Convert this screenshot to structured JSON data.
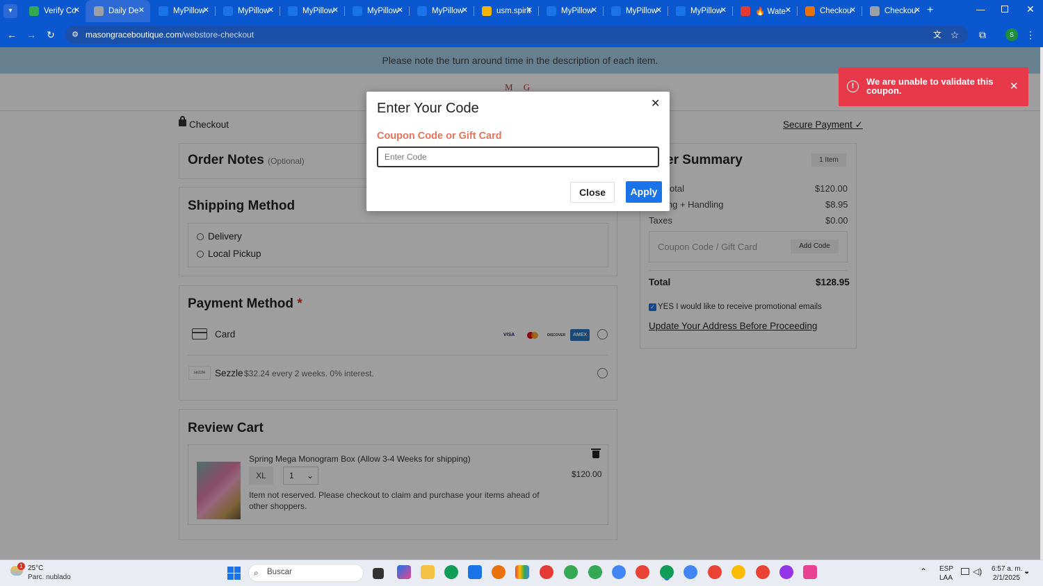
{
  "browser": {
    "tabs": [
      {
        "title": "Verify Co",
        "icon": "check-badge-icon",
        "icon_color": "#34a853"
      },
      {
        "title": "Daily De",
        "icon": "globe-icon",
        "icon_color": "#9aa0a6",
        "active": true
      },
      {
        "title": "MyPillow",
        "icon": "mypillow-icon",
        "icon_color": "#1a73e8"
      },
      {
        "title": "MyPillow",
        "icon": "mypillow-icon",
        "icon_color": "#1a73e8"
      },
      {
        "title": "MyPillow",
        "icon": "mypillow-icon",
        "icon_color": "#1a73e8"
      },
      {
        "title": "MyPillow",
        "icon": "mypillow-icon",
        "icon_color": "#1a73e8"
      },
      {
        "title": "MyPillow",
        "icon": "mypillow-icon",
        "icon_color": "#1a73e8"
      },
      {
        "title": "usm.spirit",
        "icon": "usm-icon",
        "icon_color": "#f4b400"
      },
      {
        "title": "MyPillow",
        "icon": "mypillow-icon",
        "icon_color": "#1a73e8"
      },
      {
        "title": "MyPillow",
        "icon": "mypillow-icon",
        "icon_color": "#1a73e8"
      },
      {
        "title": "MyPillow",
        "icon": "mypillow-icon",
        "icon_color": "#1a73e8"
      },
      {
        "title": "🔥 Wate",
        "icon": "temu-icon",
        "icon_color": "#e53935"
      },
      {
        "title": "Checkou",
        "icon": "sun-icon",
        "icon_color": "#e8710a"
      },
      {
        "title": "Checkou",
        "icon": "globe-icon",
        "icon_color": "#9aa0a6"
      }
    ],
    "url_host": "masongraceboutique.com",
    "url_path": "/webstore-checkout",
    "profile_initial": "S"
  },
  "page": {
    "announcement": "Please note the turn around time in the description of each item.",
    "logo_text": "M G",
    "checkout_label": "Checkout",
    "secure_payment": "Secure Payment",
    "order_notes": {
      "title": "Order Notes",
      "optional": "(Optional)"
    },
    "shipping": {
      "title": "Shipping Method",
      "options": [
        "Delivery",
        "Local Pickup"
      ]
    },
    "payment": {
      "title": "Payment Method",
      "required_mark": "*",
      "card_label": "Card",
      "card_brands": [
        "VISA",
        "MC",
        "DISCOVER",
        "AMEX"
      ],
      "sezzle_logo": "sezzle",
      "sezzle_label": "Sezzle",
      "sezzle_desc": "$32.24 every 2 weeks. 0% interest."
    },
    "cart": {
      "title": "Review Cart",
      "item_name": "Spring Mega Monogram Box (Allow 3-4 Weeks for shipping)",
      "size": "XL",
      "qty": "1",
      "price": "$120.00",
      "note": "Item not reserved. Please checkout to claim and purchase your items ahead of other shoppers."
    },
    "summary": {
      "title": "Order Summary",
      "title_visible": "er Summary",
      "items_badge": "1 Item",
      "subtotal_label": "otal",
      "subtotal": "$120.00",
      "shipping_label": "ing + Handling",
      "shipping": "$8.95",
      "taxes_label": "Taxes",
      "taxes": "$0.00",
      "coupon_placeholder": "Coupon Code / Gift Card",
      "add_code": "Add Code",
      "total_label": "Total",
      "total": "$128.95",
      "promo_label": "YES I would like to receive promotional emails",
      "promo_checked": true,
      "update_address": "Update Your Address Before Proceeding"
    }
  },
  "modal": {
    "title": "Enter Your Code",
    "field_label": "Coupon Code or Gift Card",
    "placeholder": "Enter Code",
    "close_label": "Close",
    "apply_label": "Apply",
    "label_color": "#e8735a",
    "apply_color": "#1a73e8"
  },
  "toast": {
    "message": "We are unable to validate this coupon.",
    "color": "#e8394a"
  },
  "taskbar": {
    "weather_temp": "25°C",
    "weather_desc": "Parc. nublado",
    "weather_badge": "1",
    "search_placeholder": "Buscar",
    "lang_top": "ESP",
    "lang_bottom": "LAA",
    "time": "6:57 a. m.",
    "date": "2/1/2025"
  }
}
